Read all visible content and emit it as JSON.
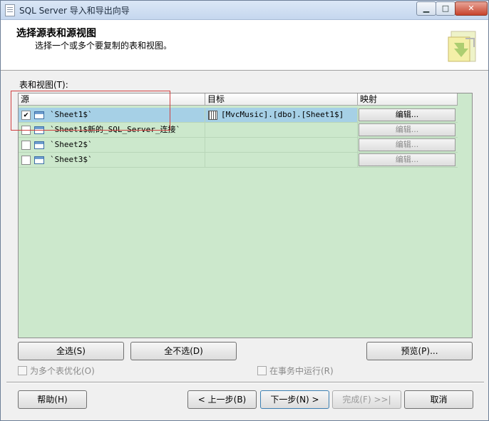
{
  "window": {
    "title": "SQL Server 导入和导出向导"
  },
  "header": {
    "title": "选择源表和源视图",
    "subtitle": "选择一个或多个要复制的表和视图。"
  },
  "tables_label": "表和视图(T):",
  "columns": {
    "source": "源",
    "destination": "目标",
    "mapping": "映射"
  },
  "rows": [
    {
      "checked": "✔",
      "source": "`Sheet1$`",
      "destination": "[MvcMusic].[dbo].[Sheet1$]",
      "mapping": "编辑...",
      "selected": true
    },
    {
      "checked": "",
      "source": "`Sheet1$新的_SQL_Server_连接`",
      "destination": "",
      "mapping": "编辑...",
      "selected": false
    },
    {
      "checked": "",
      "source": "`Sheet2$`",
      "destination": "",
      "mapping": "编辑...",
      "selected": false
    },
    {
      "checked": "",
      "source": "`Sheet3$`",
      "destination": "",
      "mapping": "编辑...",
      "selected": false
    }
  ],
  "actions": {
    "select_all": "全选(S)",
    "deselect_all": "全不选(D)",
    "preview": "预览(P)..."
  },
  "options": {
    "optimize": "为多个表优化(O)",
    "transaction": "在事务中运行(R)"
  },
  "footer": {
    "help": "帮助(H)",
    "back": "< 上一步(B)",
    "next": "下一步(N) >",
    "finish": "完成(F) >>|",
    "cancel": "取消"
  },
  "colors": {
    "grid_bg": "#cce8cc",
    "selection": "#a6d0e6",
    "highlight_box": "#d04040"
  },
  "icons": {
    "app": "document-icon",
    "logo": "wizard-logo-icon",
    "table": "table-icon",
    "destination": "db-table-icon"
  }
}
